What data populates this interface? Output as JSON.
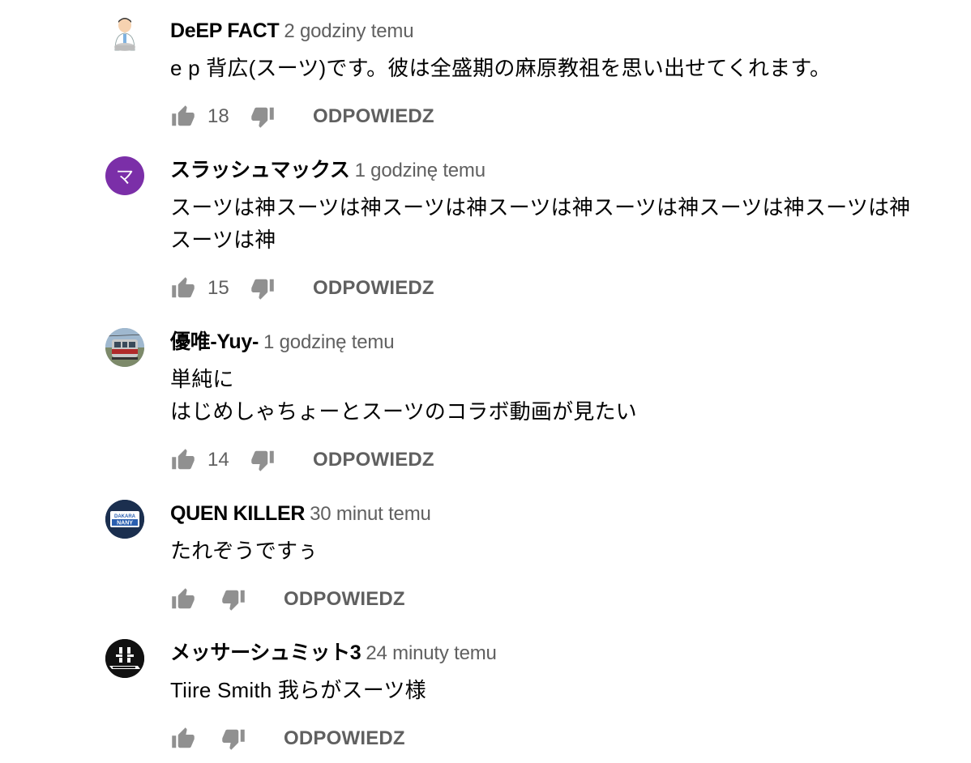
{
  "comments": [
    {
      "author": "DeEP FACT",
      "time": "2 godziny temu",
      "text": "e p 背広(スーツ)です。彼は全盛期の麻原教祖を思い出せてくれます。",
      "likes": "18",
      "reply_label": "ODPOWIEDZ",
      "avatar": "illustrated-man-avatar"
    },
    {
      "author": "スラッシュマックス",
      "time": "1 godzinę temu",
      "text": "スーツは神スーツは神スーツは神スーツは神スーツは神スーツは神スーツは神\nスーツは神",
      "likes": "15",
      "reply_label": "ODPOWIEDZ",
      "avatar_letter": "マ",
      "avatar_color": "#7b2fa8"
    },
    {
      "author": "優唯-Yuy-",
      "time": "1 godzinę temu",
      "text": "単純に\nはじめしゃちょーとスーツのコラボ動画が見たい",
      "likes": "14",
      "reply_label": "ODPOWIEDZ",
      "avatar": "train-photo-avatar"
    },
    {
      "author": "QUEN KILLER",
      "time": "30 minut temu",
      "text": "たれぞうですぅ",
      "likes": "",
      "reply_label": "ODPOWIEDZ",
      "avatar": "dakara-nany-logo-avatar",
      "avatar_logo_line1": "DAKARA",
      "avatar_logo_line2": "NANY"
    },
    {
      "author": "メッサーシュミット3",
      "time": "24 minuty temu",
      "text": "Tiire Smith 我らがスーツ様",
      "likes": "",
      "reply_label": "ODPOWIEDZ",
      "avatar": "dark-emblem-avatar"
    }
  ],
  "colors": {
    "author": "#030303",
    "meta": "#606060",
    "icon": "#909090"
  },
  "icons": {
    "like": "thumb-up-icon",
    "dislike": "thumb-down-icon"
  }
}
